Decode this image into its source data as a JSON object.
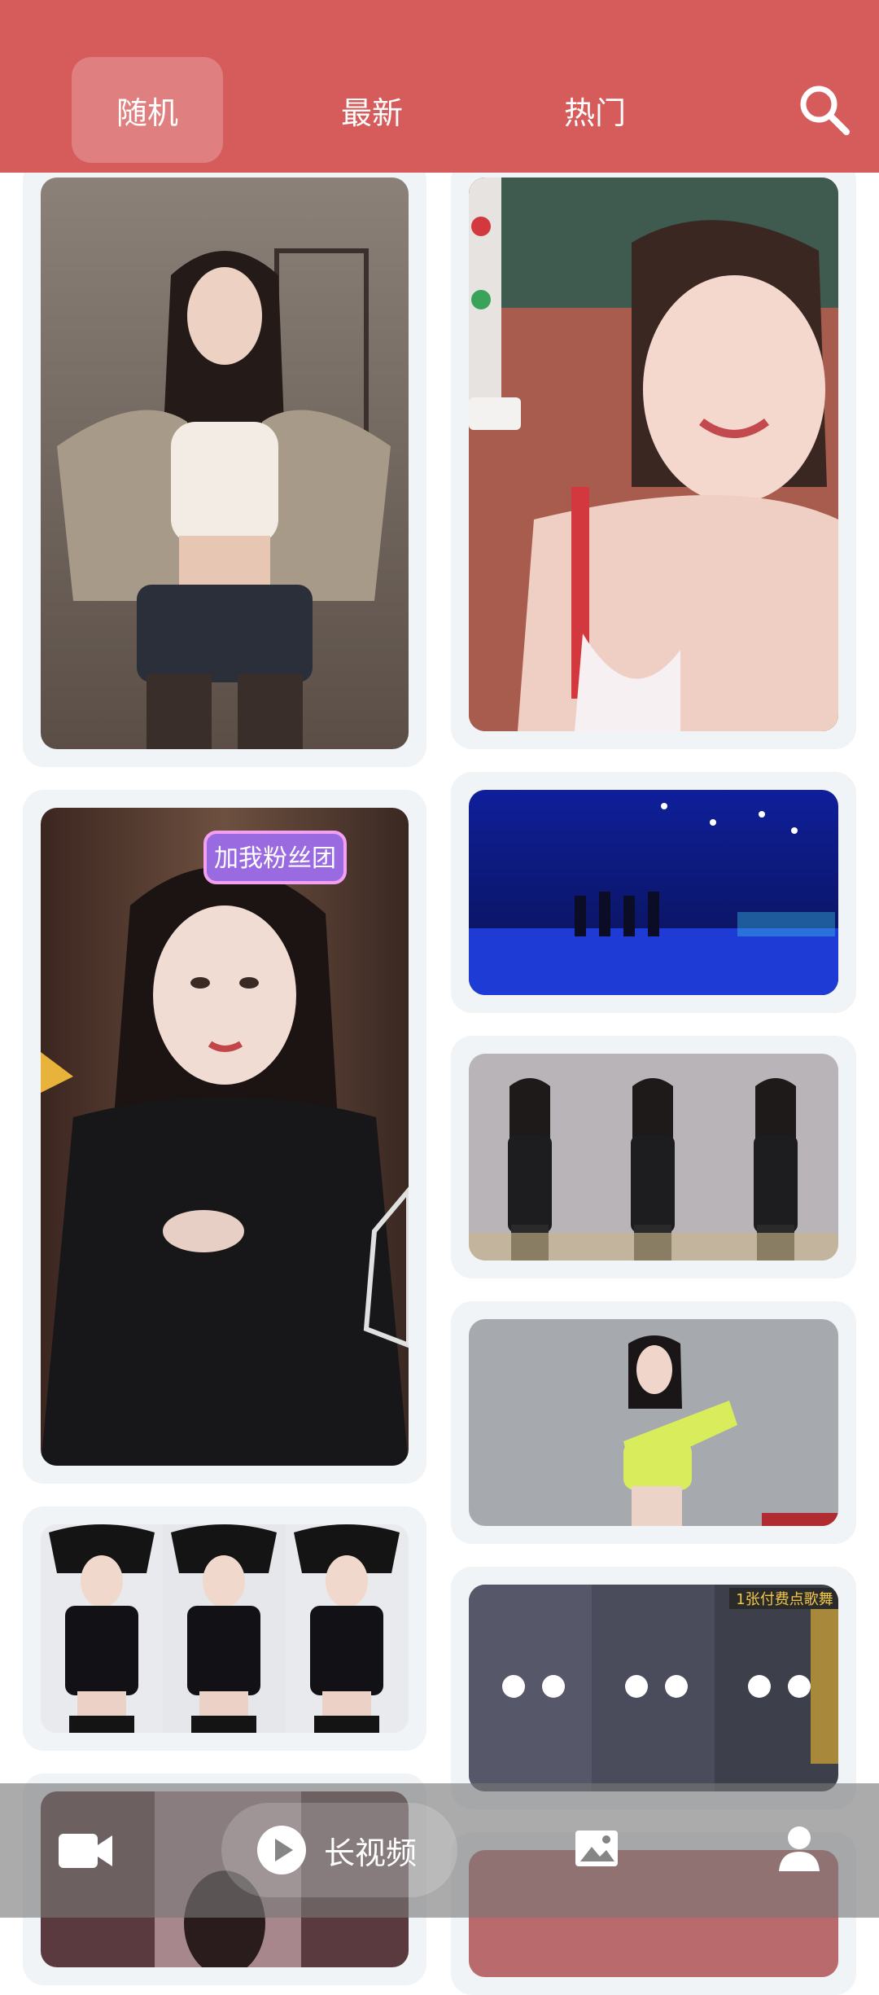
{
  "header": {
    "tabs": [
      {
        "label": "随机",
        "active": true
      },
      {
        "label": "最新",
        "active": false
      },
      {
        "label": "热门",
        "active": false
      }
    ],
    "search_icon": "search-icon"
  },
  "overlay_texts": {
    "fan_club_sticker": "加我粉丝团",
    "paid_dance_banner": "1张付费点歌舞"
  },
  "bottom_nav": {
    "items": [
      {
        "icon": "video-camera-icon"
      },
      {
        "icon": "play-icon",
        "label": "长视频"
      },
      {
        "icon": "image-icon"
      },
      {
        "icon": "user-icon"
      }
    ]
  },
  "colors": {
    "header": "#d65b5b",
    "card_bg": "#f1f4f6",
    "nav_bg": "#787878"
  }
}
